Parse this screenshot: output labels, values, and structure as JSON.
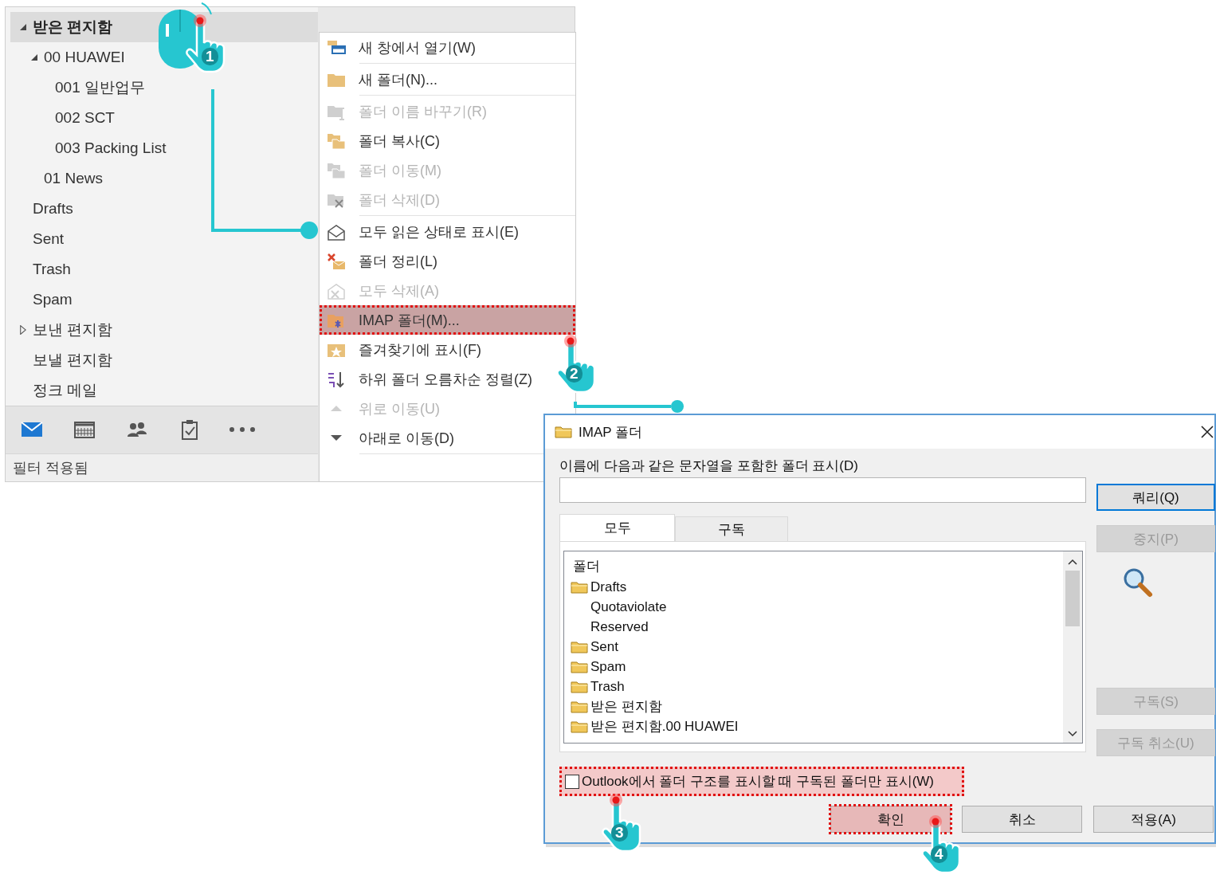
{
  "folder_pane": {
    "items": [
      {
        "label": "받은 편지함",
        "expanded": true,
        "selected": true,
        "children": [
          {
            "label": "00 HUAWEI",
            "expanded": true,
            "selected": false,
            "children": [
              {
                "label": "001 일반업무",
                "selected": false
              },
              {
                "label": "002 SCT",
                "selected": false
              },
              {
                "label": "003 Packing List",
                "selected": false
              }
            ]
          },
          {
            "label": "01 News",
            "selected": false
          }
        ]
      },
      {
        "label": "Drafts",
        "selected": false
      },
      {
        "label": "Sent",
        "selected": false
      },
      {
        "label": "Trash",
        "selected": false
      },
      {
        "label": "Spam",
        "selected": false
      },
      {
        "label": "보낸 편지함",
        "expanded": false,
        "selected": false
      },
      {
        "label": "보낼 편지함",
        "selected": false
      },
      {
        "label": "정크 메일",
        "selected": false
      }
    ],
    "nav": [
      {
        "kind": "mail",
        "selected": true
      },
      {
        "kind": "calendar",
        "selected": false
      },
      {
        "kind": "people",
        "selected": false
      },
      {
        "kind": "tasks",
        "selected": false
      },
      {
        "kind": "more",
        "selected": false
      }
    ],
    "status_bar": "필터 적용됨"
  },
  "context_menu": {
    "items": [
      {
        "label": "새 창에서 열기(W)",
        "kind": "window",
        "disabled": false,
        "selected": false,
        "separator_after": true
      },
      {
        "label": "새 폴더(N)...",
        "kind": "folder",
        "disabled": false,
        "selected": false,
        "separator_after": true
      },
      {
        "label": "폴더 이름 바꾸기(R)",
        "kind": "rename",
        "disabled": true,
        "selected": false,
        "separator_after": false
      },
      {
        "label": "폴더 복사(C)",
        "kind": "copy",
        "disabled": false,
        "selected": false,
        "separator_after": false
      },
      {
        "label": "폴더 이동(M)",
        "kind": "copy",
        "disabled": true,
        "selected": false,
        "separator_after": false
      },
      {
        "label": "폴더 삭제(D)",
        "kind": "delete",
        "disabled": true,
        "selected": false,
        "separator_after": true
      },
      {
        "label": "모두 읽은 상태로 표시(E)",
        "kind": "envelope",
        "disabled": false,
        "selected": false,
        "separator_after": false
      },
      {
        "label": "폴더 정리(L)",
        "kind": "cleanup",
        "disabled": false,
        "selected": false,
        "separator_after": false
      },
      {
        "label": "모두 삭제(A)",
        "kind": "envelope-x",
        "disabled": true,
        "selected": false,
        "separator_after": false
      },
      {
        "label": "IMAP 폴더(M)...",
        "kind": "imap",
        "disabled": false,
        "selected": true,
        "separator_after": false
      },
      {
        "label": "즐겨찾기에 표시(F)",
        "kind": "star",
        "disabled": false,
        "selected": false,
        "separator_after": false
      },
      {
        "label": "하위 폴더 오름차순 정렬(Z)",
        "kind": "sort",
        "disabled": false,
        "selected": false,
        "separator_after": false
      },
      {
        "label": "위로 이동(U)",
        "kind": "up",
        "disabled": true,
        "selected": false,
        "separator_after": false
      },
      {
        "label": "아래로 이동(D)",
        "kind": "down",
        "disabled": false,
        "selected": false,
        "separator_after": true
      }
    ]
  },
  "dialog": {
    "title": "IMAP 폴더",
    "filter_label": "이름에 다음과 같은 문자열을 포함한 폴더 표시(D)",
    "tabs": [
      {
        "label": "모두",
        "selected": true
      },
      {
        "label": "구독",
        "selected": false
      }
    ],
    "list_header": "폴더",
    "folders": [
      {
        "label": "Drafts",
        "icon": true
      },
      {
        "label": "Quotaviolate",
        "icon": false
      },
      {
        "label": "Reserved",
        "icon": false
      },
      {
        "label": "Sent",
        "icon": true
      },
      {
        "label": "Spam",
        "icon": true
      },
      {
        "label": "Trash",
        "icon": true
      },
      {
        "label": "받은 편지함",
        "icon": true
      },
      {
        "label": "받은 편지함.00 HUAWEI",
        "icon": true
      }
    ],
    "side_buttons": [
      {
        "label": "쿼리(Q)",
        "disabled": false,
        "default": true
      },
      {
        "label": "중지(P)",
        "disabled": true,
        "default": false
      },
      {
        "label": "구독(S)",
        "disabled": true,
        "default": false
      },
      {
        "label": "구독 취소(U)",
        "disabled": true,
        "default": false
      }
    ],
    "checkbox": {
      "label": "Outlook에서 폴더 구조를 표시할 때 구독된 폴더만 표시(W)",
      "checked": false,
      "selected": true
    },
    "buttons": [
      {
        "label": "확인",
        "selected": true
      },
      {
        "label": "취소",
        "selected": false
      },
      {
        "label": "적용(A)",
        "selected": false
      }
    ]
  },
  "steps": [
    {
      "number": "1",
      "kind": "mouse"
    },
    {
      "number": "2",
      "kind": "hand"
    },
    {
      "number": "3",
      "kind": "hand"
    },
    {
      "number": "4",
      "kind": "hand"
    }
  ]
}
